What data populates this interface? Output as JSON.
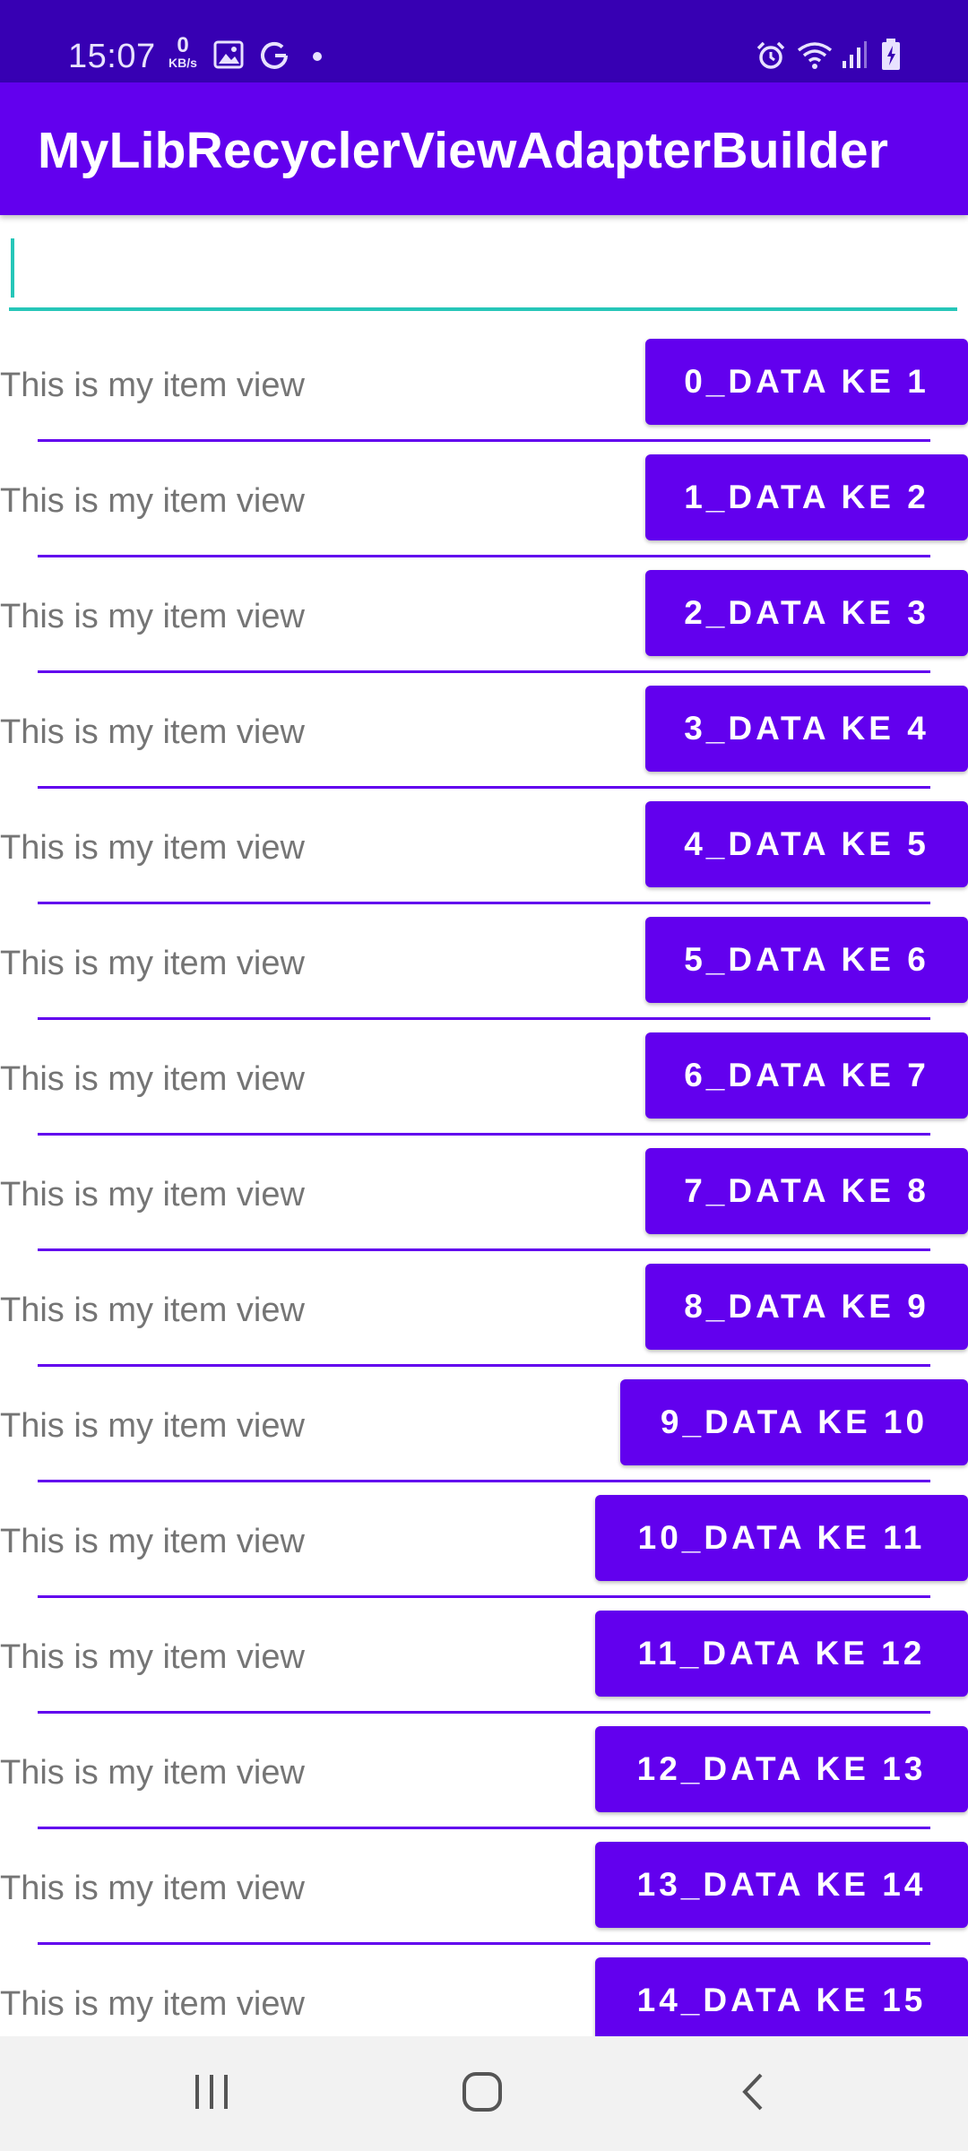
{
  "status_bar": {
    "time": "15:07",
    "speed_value": "0",
    "speed_unit": "KB/s",
    "icons": [
      "image-icon",
      "g-icon",
      "dot-icon",
      "alarm-icon",
      "wifi-icon",
      "signal-icon",
      "battery-charging-icon"
    ]
  },
  "app_bar": {
    "title": "MyLibRecyclerViewAdapterBuilder"
  },
  "search": {
    "value": "",
    "placeholder": ""
  },
  "items": [
    {
      "text": "This is my item view",
      "button": "0_DATA KE 1"
    },
    {
      "text": "This is my item view",
      "button": "1_DATA KE 2"
    },
    {
      "text": "This is my item view",
      "button": "2_DATA KE 3"
    },
    {
      "text": "This is my item view",
      "button": "3_DATA KE 4"
    },
    {
      "text": "This is my item view",
      "button": "4_DATA KE 5"
    },
    {
      "text": "This is my item view",
      "button": "5_DATA KE 6"
    },
    {
      "text": "This is my item view",
      "button": "6_DATA KE 7"
    },
    {
      "text": "This is my item view",
      "button": "7_DATA KE 8"
    },
    {
      "text": "This is my item view",
      "button": "8_DATA KE 9"
    },
    {
      "text": "This is my item view",
      "button": "9_DATA KE 10"
    },
    {
      "text": "This is my item view",
      "button": "10_DATA KE 11"
    },
    {
      "text": "This is my item view",
      "button": "11_DATA KE 12"
    },
    {
      "text": "This is my item view",
      "button": "12_DATA KE 13"
    },
    {
      "text": "This is my item view",
      "button": "13_DATA KE 14"
    },
    {
      "text": "This is my item view",
      "button": "14_DATA KE 15"
    }
  ],
  "nav_bar": {
    "icons": [
      "recent-apps-icon",
      "home-icon",
      "back-icon"
    ]
  },
  "colors": {
    "status_bar": "#3700b3",
    "primary": "#6200ee",
    "accent": "#26c6b8",
    "item_text": "#757575",
    "nav_bar": "#f2f2f2"
  }
}
